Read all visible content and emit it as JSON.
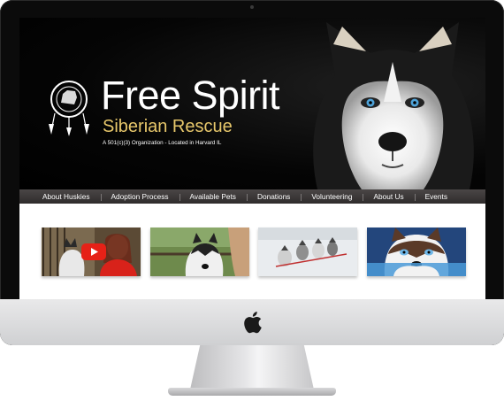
{
  "site": {
    "title": "Free Spirit",
    "subtitle": "Siberian Rescue",
    "tagline": "A 501(c)(3) Organization - Located in Harvard IL"
  },
  "nav": {
    "items": [
      {
        "label": "About Huskies"
      },
      {
        "label": "Adoption Process"
      },
      {
        "label": "Available Pets"
      },
      {
        "label": "Donations"
      },
      {
        "label": "Volunteering"
      },
      {
        "label": "About Us"
      },
      {
        "label": "Events"
      }
    ]
  },
  "thumbnails": [
    {
      "name": "video-thumbnail",
      "icon": "play-icon"
    },
    {
      "name": "husky-with-person-photo"
    },
    {
      "name": "sled-team-photo"
    },
    {
      "name": "husky-puppy-photo"
    }
  ],
  "colors": {
    "title": "#ffffff",
    "subtitle": "#e7c76b",
    "nav_bg": "#3a3636",
    "play_button": "#e62117"
  }
}
